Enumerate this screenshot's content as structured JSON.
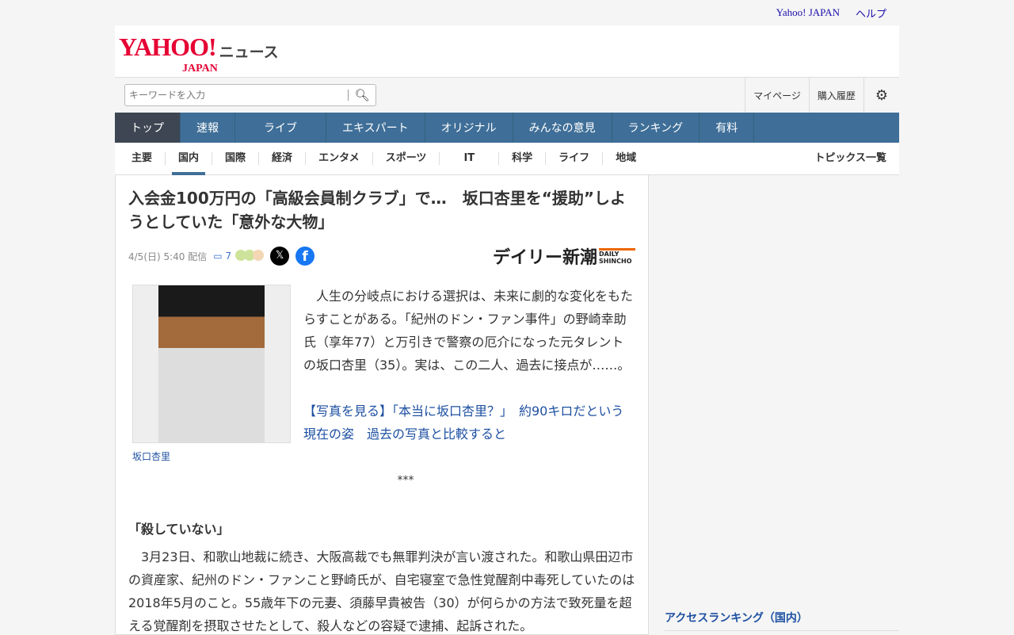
{
  "topbar": {
    "yahoo": "Yahoo! JAPAN",
    "help": "ヘルプ"
  },
  "logo": {
    "yahoo": "YAHOO!",
    "japan": "JAPAN",
    "news": "ニュース"
  },
  "search": {
    "placeholder": "キーワードを入力"
  },
  "header_links": {
    "mypage": "マイページ",
    "history": "購入履歴"
  },
  "gnav": [
    "トップ",
    "速報",
    "ライブ",
    "エキスパート",
    "オリジナル",
    "みんなの意見",
    "ランキング",
    "有料"
  ],
  "snav": [
    "主要",
    "国内",
    "国際",
    "経済",
    "エンタメ",
    "スポーツ",
    "IT",
    "科学",
    "ライフ",
    "地域"
  ],
  "topics": "トピックス一覧",
  "article": {
    "title": "入会金100万円の「高級会員制クラブ」で…　坂口杏里を“援助”しようとしていた「意外な大物」",
    "date": "4/5(日) 5:40 配信",
    "comments": "7",
    "source": "デイリー新潮",
    "source_en": "DAILY SHINCHO",
    "caption": "坂口杏里",
    "lead": "　人生の分岐点における選択は、未来に劇的な変化をもたらすことがある。「紀州のドン・ファン事件」の野崎幸助氏（享年77）と万引きで警察の厄介になった元タレントの坂口杏里（35）。実は、この二人、過去に接点が……。",
    "link": "【写真を見る】「本当に坂口杏里？」　約90キロだという現在の姿　過去の写真と比較すると",
    "stars": "***",
    "heading": "「殺していない」",
    "para": "　3月23日、和歌山地裁に続き、大阪高裁でも無罪判決が言い渡された。和歌山県田辺市の資産家、紀州のドン・ファンこと野崎氏が、自宅寝室で急性覚醒剤中毒死していたのは2018年5月のこと。55歳年下の元妻、須藤早貴被告（30）が何らかの方法で致死量を超える覚醒剤を摂取させたとして、殺人などの容疑で逮捕、起訴された。"
  },
  "sidebar": {
    "ranking": "アクセスランキング（国内）"
  }
}
